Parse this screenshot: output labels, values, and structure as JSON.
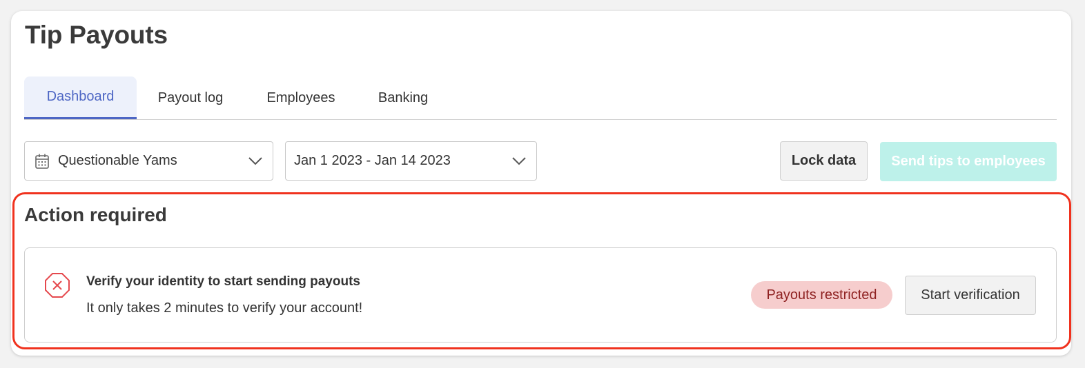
{
  "header": {
    "title": "Tip Payouts"
  },
  "tabs": [
    {
      "label": "Dashboard",
      "active": true
    },
    {
      "label": "Payout log",
      "active": false
    },
    {
      "label": "Employees",
      "active": false
    },
    {
      "label": "Banking",
      "active": false
    }
  ],
  "filters": {
    "location": {
      "value": "Questionable Yams",
      "icon": "calendar-icon"
    },
    "date_range": {
      "value": "Jan 1 2023 - Jan 14 2023"
    }
  },
  "toolbar": {
    "lock_label": "Lock data",
    "send_label": "Send tips to employees"
  },
  "action_section": {
    "title": "Action required",
    "alert": {
      "icon": "error-octagon-icon",
      "title": "Verify your identity to start sending payouts",
      "subtitle": "It only takes 2 minutes to verify your account!",
      "badge": "Payouts restricted",
      "button_label": "Start verification"
    }
  },
  "colors": {
    "accent": "#4d66c4",
    "send_button": "#bdf1ea",
    "alert_frame": "#f0321e",
    "badge_bg": "#f6cdcd",
    "badge_text": "#8f2222",
    "error_icon": "#e5484d"
  }
}
